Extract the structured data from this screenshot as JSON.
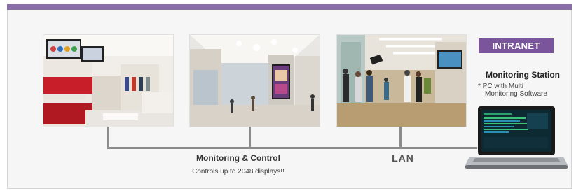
{
  "network": {
    "intranet_label": "INTRANET",
    "lan_label": "LAN",
    "monitoring_control_label": "Monitoring & Control",
    "monitoring_control_sub": "Controls up to 2048 displays!!"
  },
  "station": {
    "title": "Monitoring Station",
    "note_line1": "* PC with Multi",
    "note_line2": "Monitoring Software"
  },
  "photos": [
    {
      "name": "retail-store-photo"
    },
    {
      "name": "shopping-mall-photo"
    },
    {
      "name": "office-lobby-photo"
    }
  ],
  "colors": {
    "accent": "#7a559c",
    "line": "#8c8c8c",
    "panel": "#f6f6f7"
  }
}
